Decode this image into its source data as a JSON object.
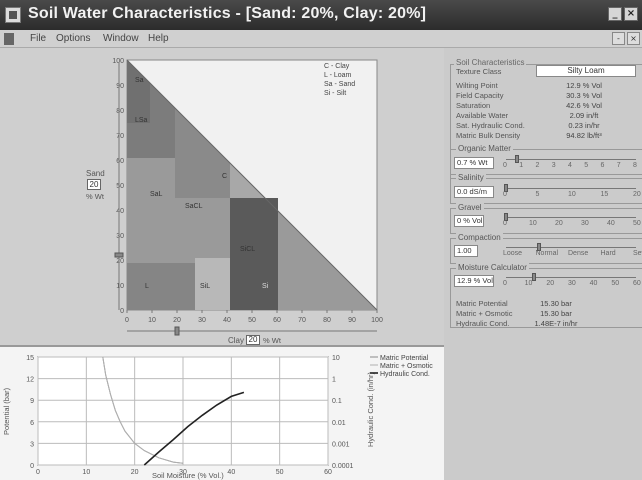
{
  "window": {
    "title": "Soil Water Characteristics  - [Sand: 20%, Clay: 20%]",
    "controls": [
      "_",
      "×"
    ]
  },
  "menu": {
    "items": [
      "File",
      "Options",
      "Window",
      "Help"
    ],
    "mdi_controls": [
      "-",
      "×"
    ]
  },
  "triangle": {
    "sand_label": "Sand",
    "sand_value": "20",
    "sand_unit": "% Wt",
    "clay_label": "Clay",
    "clay_value": "20",
    "clay_unit": "% Wt",
    "y_ticks": [
      "100",
      "90",
      "80",
      "70",
      "60",
      "50",
      "40",
      "30",
      "20",
      "10",
      "0"
    ],
    "x_ticks": [
      "0",
      "10",
      "20",
      "30",
      "40",
      "50",
      "60",
      "70",
      "80",
      "90",
      "100"
    ],
    "legend": [
      "C - Clay",
      "L - Loam",
      "Sa - Sand",
      "Si - Silt"
    ],
    "region_labels": [
      "Sa",
      "LSa",
      "SaL",
      "SaCL",
      "L",
      "SiL",
      "SiCL",
      "C",
      "Si"
    ]
  },
  "soil_characteristics": {
    "section_title": "Soil Characteristics",
    "rows": [
      {
        "label": "Texture Class",
        "value": "Silty Loam"
      },
      {
        "label": "Wilting Point",
        "value": "12.9 % Vol"
      },
      {
        "label": "Field Capacity",
        "value": "30.3 % Vol"
      },
      {
        "label": "Saturation",
        "value": "42.6 % Vol"
      },
      {
        "label": "Available Water",
        "value": "2.09 in/ft"
      },
      {
        "label": "Sat. Hydraulic Cond.",
        "value": "0.23 in/hr"
      },
      {
        "label": "Matric Bulk Density",
        "value": "94.82 lb/ft³"
      }
    ]
  },
  "organic_matter": {
    "title": "Organic Matter",
    "value": "0.7 % Wt",
    "ticks": [
      "0",
      "1",
      "2",
      "3",
      "4",
      "5",
      "6",
      "7",
      "8"
    ],
    "level": 0.7
  },
  "salinity": {
    "title": "Salinity",
    "value": "0.0 dS/m",
    "ticks": [
      "0",
      "5",
      "10",
      "15",
      "20"
    ],
    "level": 0.0
  },
  "gravel": {
    "title": "Gravel",
    "value": "0 % Vol",
    "ticks": [
      "0",
      "10",
      "20",
      "30",
      "40",
      "50"
    ],
    "level": 0
  },
  "compaction": {
    "title": "Compaction",
    "value": "1.00",
    "ticks": [
      "Loose",
      "Normal",
      "Dense",
      "Hard",
      "Severe"
    ],
    "level_index": 1
  },
  "moisture_calculator": {
    "title": "Moisture Calculator",
    "value": "12.9 % Vol",
    "ticks": [
      "0",
      "10",
      "20",
      "30",
      "40",
      "50",
      "60"
    ],
    "level": 12.9,
    "results": [
      {
        "label": "Matric Potential",
        "value": "15.30 bar"
      },
      {
        "label": "Matric + Osmotic",
        "value": "15.30 bar"
      },
      {
        "label": "Hydraulic Cond.",
        "value": "1.48E-7 in/hr"
      }
    ]
  },
  "chart_data": {
    "type": "line",
    "xlabel": "Soil Moisture (% Vol.)",
    "ylabel": "Potential (bar)",
    "y2label": "Hydraulic Cond. (in/hr)",
    "xlim": [
      0,
      60
    ],
    "ylim": [
      0,
      15
    ],
    "y2_scale": "log",
    "x_ticks": [
      "0",
      "10",
      "20",
      "30",
      "40",
      "50",
      "60"
    ],
    "y_ticks": [
      "0",
      "3",
      "6",
      "9",
      "12",
      "15"
    ],
    "y2_ticks": [
      "0.0001",
      "0.001",
      "0.01",
      "0.1",
      "1",
      "10"
    ],
    "legend": [
      "Matric Potential",
      "Matric + Osmotic",
      "Hydraulic Cond."
    ],
    "legend_position": "right",
    "grid": true,
    "series": [
      {
        "name": "Matric Potential",
        "axis": "left",
        "x": [
          13.4,
          14,
          15,
          16,
          17,
          18,
          20,
          22,
          25,
          28,
          30
        ],
        "y": [
          15,
          12.5,
          9.8,
          7.6,
          6.0,
          4.7,
          3.0,
          2.0,
          1.0,
          0.4,
          0.25
        ]
      },
      {
        "name": "Matric + Osmotic",
        "axis": "left",
        "x": [
          13.4,
          14,
          15,
          16,
          17,
          18,
          20,
          22,
          25,
          28,
          30
        ],
        "y": [
          15,
          12.5,
          9.8,
          7.6,
          6.0,
          4.7,
          3.0,
          2.0,
          1.0,
          0.4,
          0.25
        ]
      },
      {
        "name": "Hydraulic Cond.",
        "axis": "right",
        "x": [
          22,
          25,
          28,
          31,
          34,
          37,
          40,
          42.6
        ],
        "y": [
          0.0001,
          0.0004,
          0.0015,
          0.006,
          0.02,
          0.06,
          0.15,
          0.23
        ]
      }
    ],
    "colors": {
      "potential": "#8a8a8a",
      "osmotic": "#b0b0b0",
      "hydraulic": "#222222"
    }
  }
}
